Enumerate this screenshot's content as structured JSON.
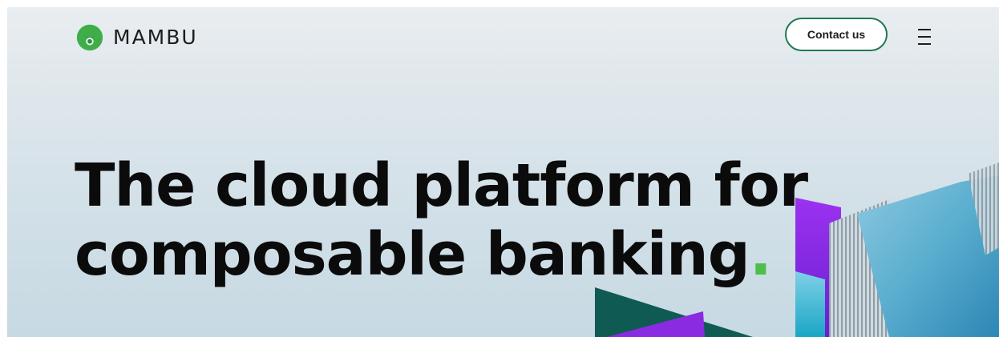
{
  "header": {
    "brand": "MAMBU",
    "contact_label": "Contact us",
    "menu_icon": "hamburger-menu-icon",
    "logo_icon": "mambu-logo-icon"
  },
  "hero": {
    "headline_line1": "The cloud platform for",
    "headline_line2": "composable banking",
    "headline_dot": ".",
    "art": "hero-building-graphic"
  },
  "colors": {
    "brand_green": "#4cbf4c",
    "button_border": "#1f7a52",
    "headline": "#0b0b0b",
    "accent_purple": "#8a2be2",
    "accent_teal": "#0f5a52"
  }
}
